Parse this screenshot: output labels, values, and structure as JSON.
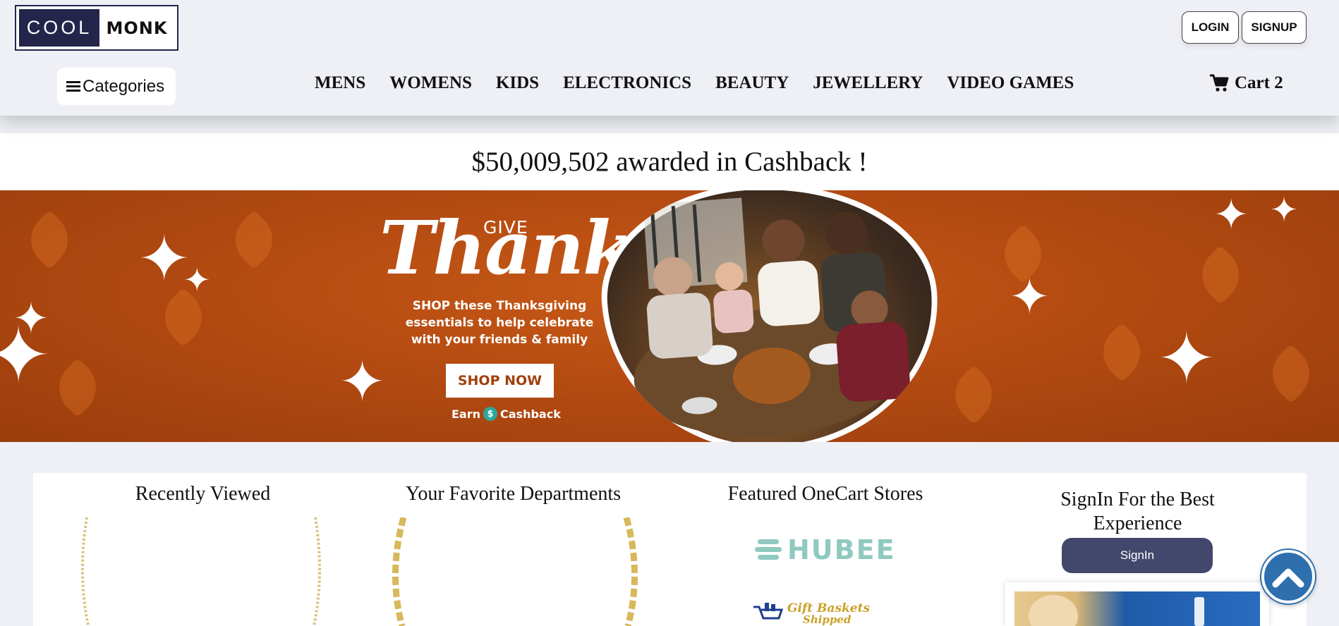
{
  "brand": {
    "logo_left": "COOL",
    "logo_right": "MONK"
  },
  "auth": {
    "login_label": "LOGIN",
    "signup_label": "SIGNUP"
  },
  "categories": {
    "label": "Categories",
    "icon": "hamburger-menu-icon"
  },
  "nav": {
    "items": [
      "MENS",
      "WOMENS",
      "KIDS",
      "ELECTRONICS",
      "BEAUTY",
      "JEWELLERY",
      "VIDEO GAMES"
    ]
  },
  "cart": {
    "label": "Cart 2",
    "icon": "shopping-cart-icon"
  },
  "cashback": {
    "text": "$50,009,502 awarded in Cashback !"
  },
  "banner": {
    "give": "GIVE",
    "thanks": "Thanks",
    "promo_text": "SHOP these Thanksgiving essentials to help celebrate with your friends & family",
    "shop_button": "SHOP NOW",
    "earn_prefix": "Earn",
    "earn_suffix": "Cashback",
    "coin_symbol": "$",
    "colors": {
      "background": "#b64c12",
      "button_text": "#a1400e",
      "coin": "#2ba79b"
    }
  },
  "sections": {
    "recently_viewed": {
      "title": "Recently Viewed"
    },
    "favorite_departments": {
      "title": "Your Favorite Departments"
    },
    "featured_stores": {
      "title": "Featured OneCart Stores",
      "stores": [
        {
          "name": "HUBEE",
          "color": "#8fc9c0"
        },
        {
          "name": "Gift Baskets",
          "sub": "Shipped",
          "color": "#c9a227"
        }
      ]
    },
    "signin": {
      "title_line1": "SignIn For the Best",
      "title_line2": "Experience",
      "button": "SignIn"
    }
  },
  "scroll_top": {
    "icon": "chevron-up-icon"
  },
  "colors": {
    "header_bg": "#eef0f5",
    "logo_dark": "#23254a",
    "signin_button": "#43476b",
    "scroll_button": "#2e6fae"
  }
}
